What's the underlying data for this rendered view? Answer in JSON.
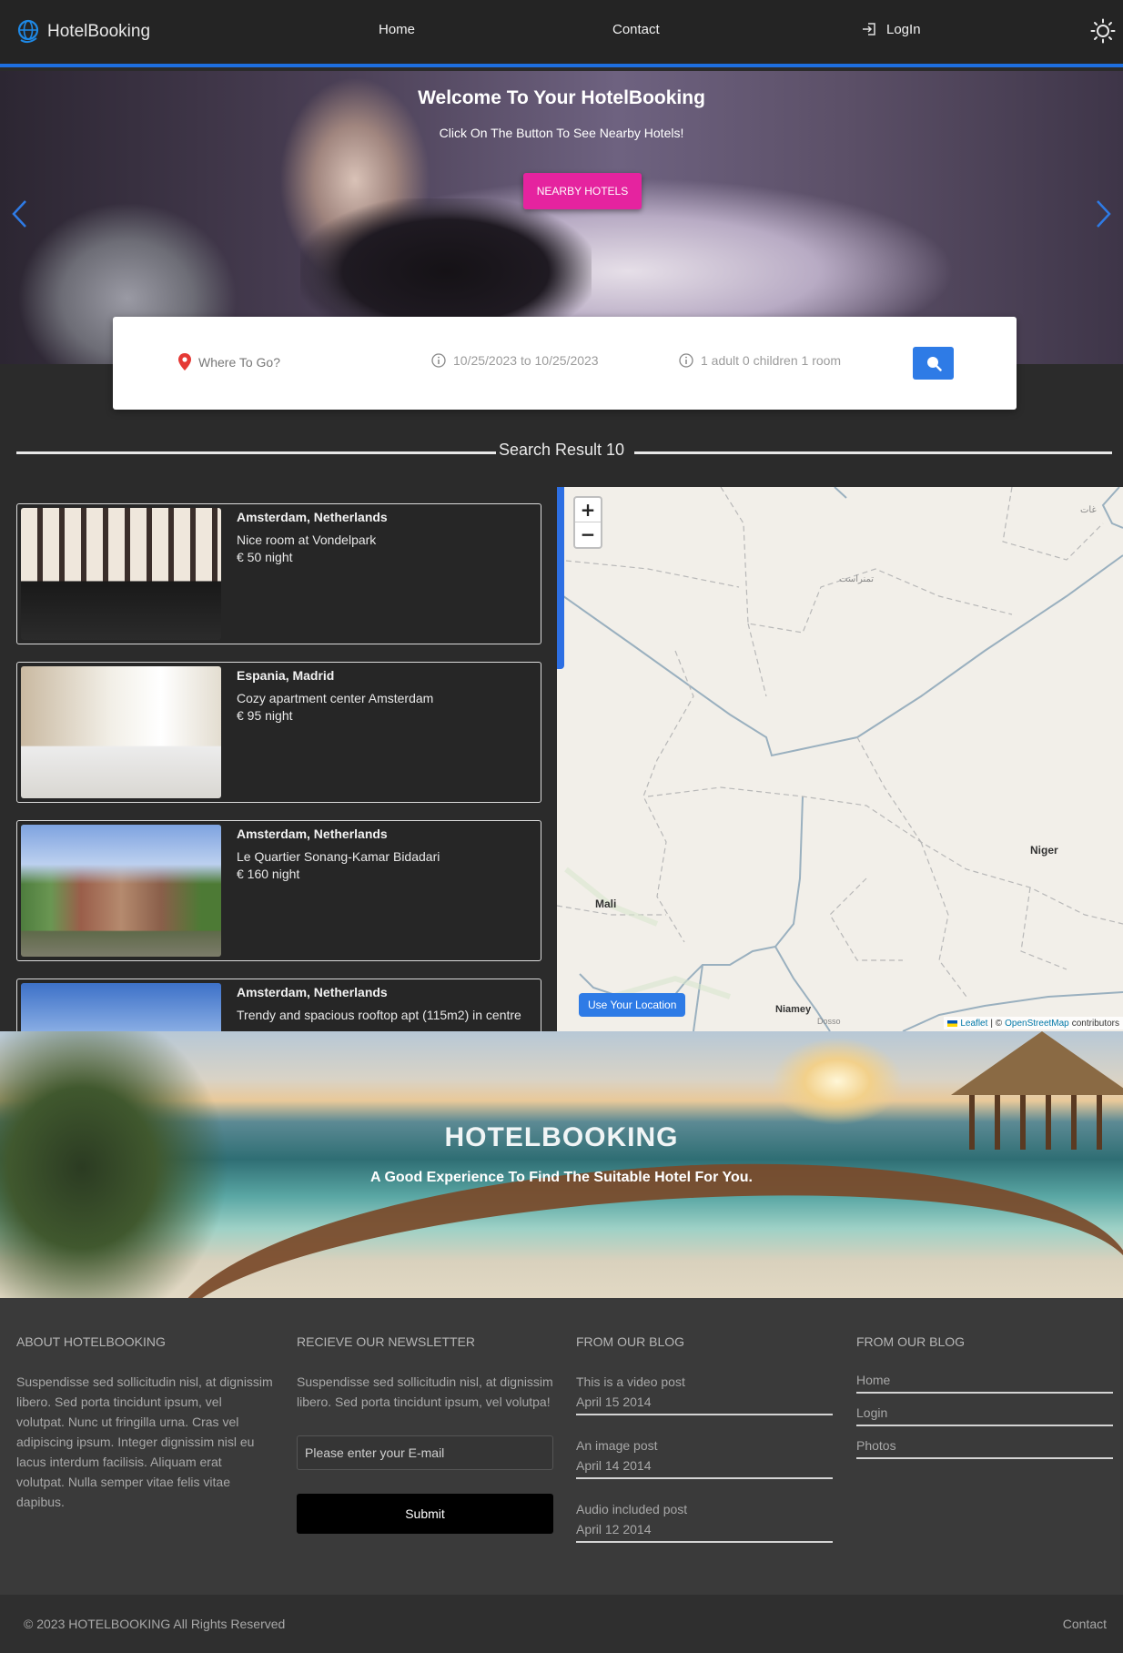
{
  "nav": {
    "brand": "HotelBooking",
    "home": "Home",
    "contact": "Contact",
    "login": "LogIn"
  },
  "hero": {
    "title": "Welcome To Your HotelBooking",
    "subtitle": "Click On The Button To See Nearby Hotels!",
    "button": "NEARBY HOTELS"
  },
  "search": {
    "where_placeholder": "Where To Go?",
    "dates": "10/25/2023 to 10/25/2023",
    "guests": "1 adult 0 children 1 room"
  },
  "results": {
    "heading": "Search Result 10",
    "items": [
      {
        "location": "Amsterdam, Netherlands",
        "name": "Nice room at Vondelpark",
        "price": "€ 50 night"
      },
      {
        "location": "Espania, Madrid",
        "name": "Cozy apartment center Amsterdam",
        "price": "€ 95 night"
      },
      {
        "location": "Amsterdam, Netherlands",
        "name": "Le Quartier Sonang-Kamar Bidadari",
        "price": "€ 160 night"
      },
      {
        "location": "Amsterdam, Netherlands",
        "name": "Trendy and spacious rooftop apt (115m2) in centre",
        "price": ""
      }
    ]
  },
  "map": {
    "zoom_in": "+",
    "zoom_out": "−",
    "labels": {
      "mali": "Mali",
      "niger": "Niger",
      "niamey": "Niamey",
      "dosso": "Dosso",
      "tamanrasset": "تمنراست",
      "ghat": "غات"
    },
    "use_location": "Use Your Location",
    "attribution_leaflet": "Leaflet",
    "attribution_sep": "| ©",
    "attribution_osm": "OpenStreetMap",
    "attribution_tail": "contributors"
  },
  "banner": {
    "title": "HOTELBOOKING",
    "subtitle": "A Good Experience To Find The Suitable Hotel For You."
  },
  "footer": {
    "about_heading": "ABOUT HOTELBOOKING",
    "about_text": "Suspendisse sed sollicitudin nisl, at dignissim libero. Sed porta tincidunt ipsum, vel volutpat. Nunc ut fringilla urna. Cras vel adipiscing ipsum. Integer dignissim nisl eu lacus interdum facilisis. Aliquam erat volutpat. Nulla semper vitae felis vitae dapibus.",
    "newsletter_heading": "RECIEVE OUR NEWSLETTER",
    "newsletter_text": "Suspendisse sed sollicitudin nisl, at dignissim libero. Sed porta tincidunt ipsum, vel volutpa!",
    "email_placeholder": "Please enter your E-mail",
    "submit": "Submit",
    "blog_heading": "FROM OUR BLOG",
    "blog": [
      {
        "title": "This is a video post",
        "date": "April 15 2014"
      },
      {
        "title": "An image post",
        "date": "April 14 2014"
      },
      {
        "title": "Audio included post",
        "date": "April 12 2014"
      }
    ],
    "links_heading": "FROM OUR BLOG",
    "links": [
      "Home",
      "Login",
      "Photos"
    ],
    "copyright": "© 2023 HOTELBOOKING All Rights Reserved",
    "bottom_contact": "Contact"
  },
  "colors": {
    "accent": "#2e7be6",
    "hero_button": "#e5239f",
    "nav_border": "#1e6fe0"
  }
}
